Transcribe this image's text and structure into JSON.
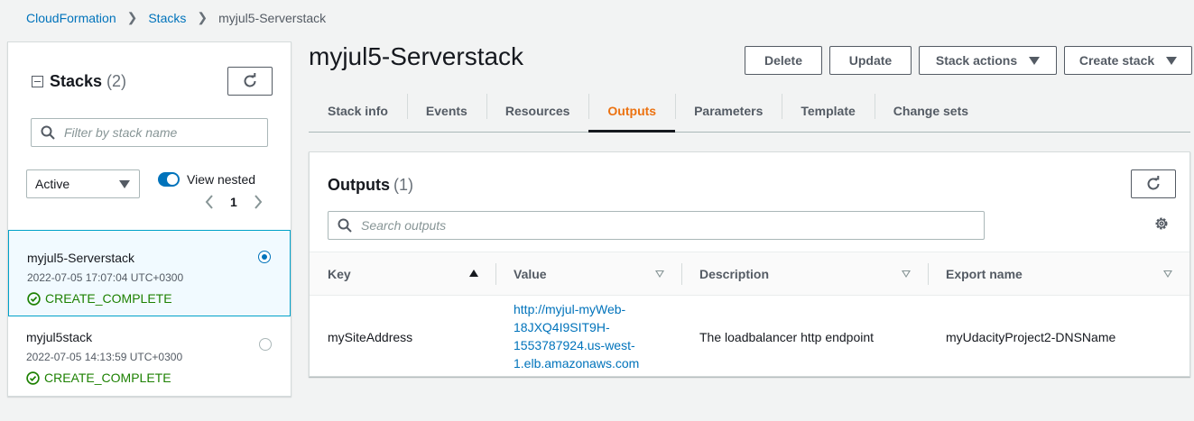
{
  "breadcrumb": {
    "root": "CloudFormation",
    "section": "Stacks",
    "current": "myjul5-Serverstack"
  },
  "stacks_panel": {
    "title": "Stacks",
    "count": "(2)",
    "search_placeholder": "Filter by stack name",
    "filter_value": "Active",
    "view_nested_label": "View nested",
    "view_nested_on": true,
    "page": "1",
    "items": [
      {
        "name": "myjul5-Serverstack",
        "time": "2022-07-05 17:07:04 UTC+0300",
        "status": "CREATE_COMPLETE",
        "selected": true
      },
      {
        "name": "myjul5stack",
        "time": "2022-07-05 14:13:59 UTC+0300",
        "status": "CREATE_COMPLETE",
        "selected": false
      }
    ]
  },
  "header": {
    "title": "myjul5-Serverstack",
    "buttons": {
      "delete": "Delete",
      "update": "Update",
      "stack_actions": "Stack actions",
      "create_stack": "Create stack"
    }
  },
  "tabs": [
    "Stack info",
    "Events",
    "Resources",
    "Outputs",
    "Parameters",
    "Template",
    "Change sets"
  ],
  "active_tab": "Outputs",
  "outputs": {
    "title": "Outputs",
    "count": "(1)",
    "search_placeholder": "Search outputs",
    "columns": {
      "key": "Key",
      "value": "Value",
      "description": "Description",
      "export": "Export name"
    },
    "rows": [
      {
        "key": "mySiteAddress",
        "value_lines": [
          "http://myjul-myWeb-",
          "18JXQ4I9SIT9H-",
          "1553787924.us-west-",
          "1.elb.amazonaws.com"
        ],
        "description": "The loadbalancer http endpoint",
        "export": "myUdacityProject2-DNSName"
      }
    ]
  },
  "colors": {
    "link": "#0073bb",
    "active_tab": "#ec7211",
    "success": "#1d8102"
  }
}
